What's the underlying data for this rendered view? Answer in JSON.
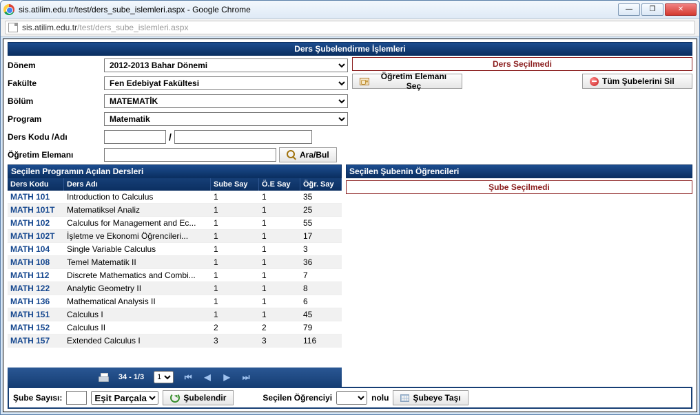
{
  "window": {
    "title": "sis.atilim.edu.tr/test/ders_sube_islemleri.aspx - Google Chrome",
    "url_host": "sis.atilim.edu.tr",
    "url_path_gray": "/test/",
    "url_path_rest": "ders_sube_islemleri.aspx"
  },
  "header_title": "Ders Şubelendirme İşlemleri",
  "filters": {
    "donem_label": "Dönem",
    "donem_value": "2012-2013 Bahar Dönemi",
    "fakulte_label": "Fakülte",
    "fakulte_value": "Fen Edebiyat Fakültesi",
    "bolum_label": "Bölüm",
    "bolum_value": "MATEMATİK",
    "program_label": "Program",
    "program_value": "Matematik",
    "ders_kodu_label": "Ders Kodu /Adı",
    "slash": "/",
    "ogretim_elemani_label": "Öğretim Elemanı",
    "ara_bul_label": "Ara/Bul"
  },
  "right_panel": {
    "status_text": "Ders Seçilmedi",
    "ogretim_elemani_sec": "Öğretim Elemanı Seç",
    "tum_subelerini_sil": "Tüm Şubelerini Sil"
  },
  "courses_panel_title": "Seçilen Programın Açılan Dersleri",
  "students_panel_title": "Seçilen Şubenin Öğrencileri",
  "students_status": "Şube Seçilmedi",
  "table": {
    "headers": {
      "c1": "Ders Kodu",
      "c2": "Ders Adı",
      "c3": "Sube Say",
      "c4": "Ö.E Say",
      "c5": "Öğr. Say"
    },
    "rows": [
      {
        "code": "MATH 101",
        "name": "Introduction to Calculus",
        "sube": 1,
        "oe": 1,
        "ogr": 35
      },
      {
        "code": "MATH 101T",
        "name": "Matematiksel Analiz",
        "sube": 1,
        "oe": 1,
        "ogr": 25
      },
      {
        "code": "MATH 102",
        "name": "Calculus for Management and Ec...",
        "sube": 1,
        "oe": 1,
        "ogr": 55
      },
      {
        "code": "MATH 102T",
        "name": "İşletme ve Ekonomi Öğrencileri...",
        "sube": 1,
        "oe": 1,
        "ogr": 17
      },
      {
        "code": "MATH 104",
        "name": "Single Variable Calculus",
        "sube": 1,
        "oe": 1,
        "ogr": 3
      },
      {
        "code": "MATH 108",
        "name": "Temel Matematik II",
        "sube": 1,
        "oe": 1,
        "ogr": 36
      },
      {
        "code": "MATH 112",
        "name": "Discrete Mathematics and Combi...",
        "sube": 1,
        "oe": 1,
        "ogr": 7
      },
      {
        "code": "MATH 122",
        "name": "Analytic Geometry II",
        "sube": 1,
        "oe": 1,
        "ogr": 8
      },
      {
        "code": "MATH 136",
        "name": "Mathematical Analysis II",
        "sube": 1,
        "oe": 1,
        "ogr": 6
      },
      {
        "code": "MATH 151",
        "name": "Calculus I",
        "sube": 1,
        "oe": 1,
        "ogr": 45
      },
      {
        "code": "MATH 152",
        "name": "Calculus II",
        "sube": 2,
        "oe": 2,
        "ogr": 79
      },
      {
        "code": "MATH 157",
        "name": "Extended Calculus I",
        "sube": 3,
        "oe": 3,
        "ogr": 116
      }
    ]
  },
  "pager": {
    "counter": "34 - 1/3",
    "page_value": "1"
  },
  "bottom": {
    "sube_sayisi_label": "Şube Sayısı:",
    "split_value": "Eşit Parçala",
    "subelendir": "Şubelendir",
    "secilen_ogrenciyi": "Seçilen Öğrenciyi",
    "nolu": "nolu",
    "subeye_tasi": "Şubeye Taşı"
  }
}
